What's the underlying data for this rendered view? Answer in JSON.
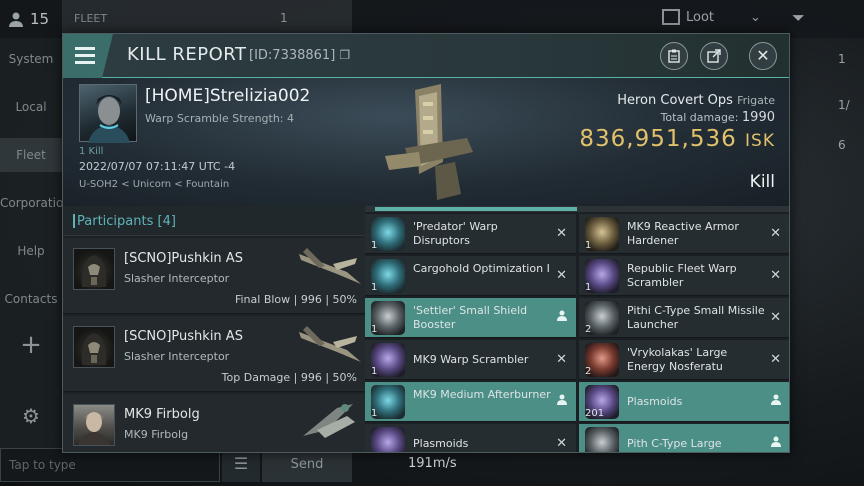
{
  "background": {
    "counter": "15",
    "fleet_label": "FLEET",
    "fleet_count": "1",
    "loot_label": "Loot",
    "left_menu": [
      "System",
      "Local",
      "Fleet",
      "Corporation",
      "Help",
      "Contacts"
    ],
    "chat_placeholder": "Tap to type",
    "send_label": "Send",
    "speed": "191m/s",
    "right_counts": [
      "1",
      "1/",
      "6"
    ]
  },
  "window": {
    "title": "KILL REPORT",
    "id_label": "[ID:7338861]",
    "buttons": [
      "clipboard-icon",
      "share-icon",
      "close-icon"
    ]
  },
  "victim": {
    "name": "[HOME]Strelizia002",
    "warp_scramble": "Warp Scramble Strength: 4",
    "kill_count": "1 Kill",
    "time": "2022/07/07 07:11:47 UTC -4",
    "location": "U-SOH2 < Unicorn < Fountain",
    "ship": "Heron Covert Ops",
    "ship_class": "Frigate",
    "total_damage_label": "Total damage:",
    "total_damage": "1990",
    "isk_value": "836,951,536",
    "isk_unit": "ISK",
    "result": "Kill"
  },
  "participants": {
    "header": "Participants [4]",
    "rows": [
      {
        "name": "[SCNO]Pushkin AS",
        "ship": "Slasher Interceptor",
        "stats": "Final Blow | 996 | 50%"
      },
      {
        "name": "[SCNO]Pushkin AS",
        "ship": "Slasher Interceptor",
        "stats": "Top Damage | 996 | 50%"
      },
      {
        "name": "MK9 Firbolg",
        "ship": "MK9 Firbolg",
        "stats": ""
      }
    ]
  },
  "fitting": {
    "left": [
      {
        "qty": "1",
        "name": "'Predator' Warp Disruptors",
        "mark": "✕",
        "highlight": false,
        "color": "blue"
      },
      {
        "qty": "1",
        "name": "Cargohold Optimization I",
        "mark": "✕",
        "highlight": false,
        "color": "blue"
      },
      {
        "qty": "1",
        "name": "'Settler' Small Shield Booster",
        "mark": "person",
        "highlight": true,
        "color": "grey"
      },
      {
        "qty": "1",
        "name": "MK9 Warp Scrambler",
        "mark": "✕",
        "highlight": false,
        "color": "purple"
      },
      {
        "qty": "1",
        "name": "MK9 Medium Afterburner",
        "mark": "person",
        "highlight": true,
        "color": "blue"
      },
      {
        "qty": "",
        "name": "Plasmoids",
        "mark": "✕",
        "highlight": false,
        "color": "purple"
      }
    ],
    "right": [
      {
        "qty": "1",
        "name": "MK9 Reactive Armor Hardener",
        "mark": "✕",
        "highlight": false,
        "color": "gold"
      },
      {
        "qty": "1",
        "name": "Republic Fleet Warp Scrambler",
        "mark": "✕",
        "highlight": false,
        "color": "purple"
      },
      {
        "qty": "2",
        "name": "Pithi C-Type Small Missile Launcher",
        "mark": "✕",
        "highlight": false,
        "color": "grey"
      },
      {
        "qty": "2",
        "name": "'Vrykolakas' Large Energy Nosferatu",
        "mark": "✕",
        "highlight": false,
        "color": "red"
      },
      {
        "qty": "201",
        "name": "Plasmoids",
        "mark": "person",
        "highlight": true,
        "color": "purple"
      },
      {
        "qty": "",
        "name": "Pith C-Type Large",
        "mark": "person",
        "highlight": true,
        "color": "grey"
      }
    ]
  }
}
